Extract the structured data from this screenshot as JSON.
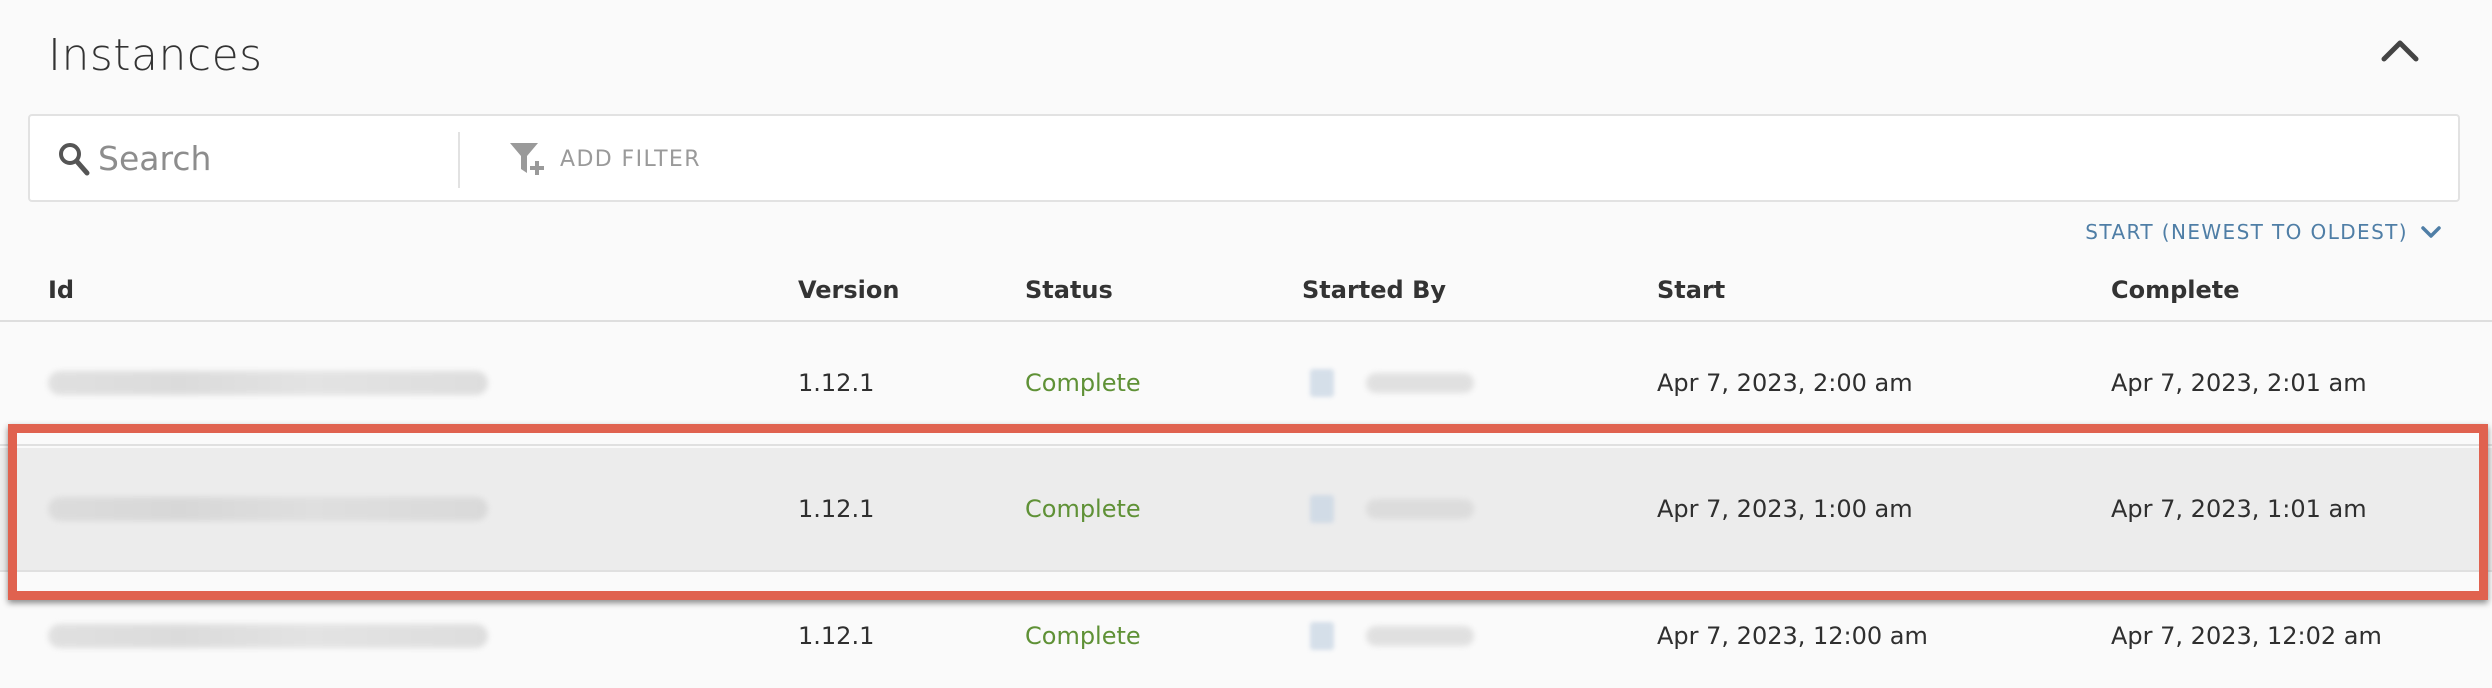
{
  "panel": {
    "title": "Instances"
  },
  "search": {
    "placeholder": "Search",
    "value": ""
  },
  "filter": {
    "label": "ADD FILTER"
  },
  "sort": {
    "label": "START (NEWEST TO OLDEST)"
  },
  "table": {
    "columns": [
      "Id",
      "Version",
      "Status",
      "Started By",
      "Start",
      "Complete"
    ],
    "rows": [
      {
        "version": "1.12.1",
        "status": "Complete",
        "start": "Apr 7, 2023, 2:00 am",
        "complete": "Apr 7, 2023, 2:01 am"
      },
      {
        "version": "1.12.1",
        "status": "Complete",
        "start": "Apr 7, 2023, 1:00 am",
        "complete": "Apr 7, 2023, 1:01 am"
      },
      {
        "version": "1.12.1",
        "status": "Complete",
        "start": "Apr 7, 2023, 12:00 am",
        "complete": "Apr 7, 2023, 12:02 am"
      }
    ]
  },
  "colors": {
    "accent": "#4f7ea6",
    "status_complete": "#5f9136",
    "highlight": "#e0624f"
  },
  "icons": {
    "collapse": "chevron-up-icon",
    "search": "search-icon",
    "filter": "filter-add-icon",
    "sort": "chevron-down-icon"
  }
}
